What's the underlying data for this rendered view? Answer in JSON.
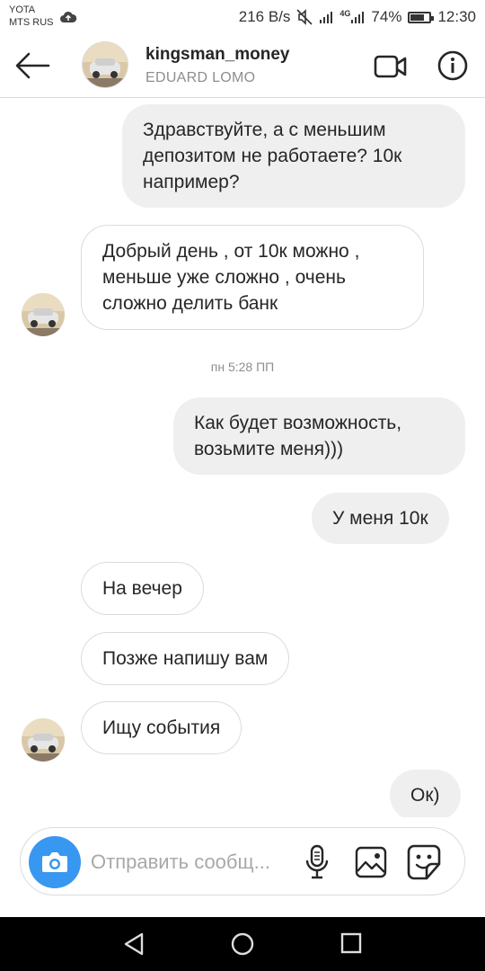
{
  "status_bar": {
    "carrier_top": "YOTA",
    "carrier_bottom": "MTS RUS",
    "net_speed": "216 B/s",
    "signal_label": "4G",
    "battery_level": 0.74,
    "battery": "74%",
    "time": "12:30"
  },
  "header": {
    "username": "kingsman_money",
    "real_name": "EDUARD LOMO"
  },
  "messages": [
    {
      "direction": "outgoing",
      "text": "Здравствуйте, а с меньшим депозитом не работаете? 10к например?"
    },
    {
      "direction": "incoming",
      "text": "Добрый день , от 10к можно , меньше уже сложно , очень сложно делить банк"
    },
    {
      "direction": "outgoing",
      "text": "Как будет возможность, возьмите меня)))"
    },
    {
      "direction": "outgoing",
      "text": "У меня 10к"
    },
    {
      "direction": "incoming",
      "text": "На вечер"
    },
    {
      "direction": "incoming",
      "text": "Позже напишу вам"
    },
    {
      "direction": "incoming",
      "text": "Ищу события"
    },
    {
      "direction": "outgoing",
      "text": "Ок)"
    }
  ],
  "timestamp": "пн 5:28 ПП",
  "composer": {
    "placeholder": "Отправить сообщ..."
  },
  "colors": {
    "accent": "#3897f0",
    "outgoing_bubble": "#efefef",
    "border": "#dbdbdb",
    "muted_text": "#8e8e8e"
  },
  "icons": [
    "cloud-upload-icon",
    "mute-icon",
    "signal-icon",
    "battery-icon",
    "back-arrow-icon",
    "video-call-icon",
    "info-icon",
    "camera-icon",
    "microphone-icon",
    "gallery-icon",
    "sticker-icon",
    "nav-back-icon",
    "nav-home-icon",
    "nav-recent-icon"
  ]
}
